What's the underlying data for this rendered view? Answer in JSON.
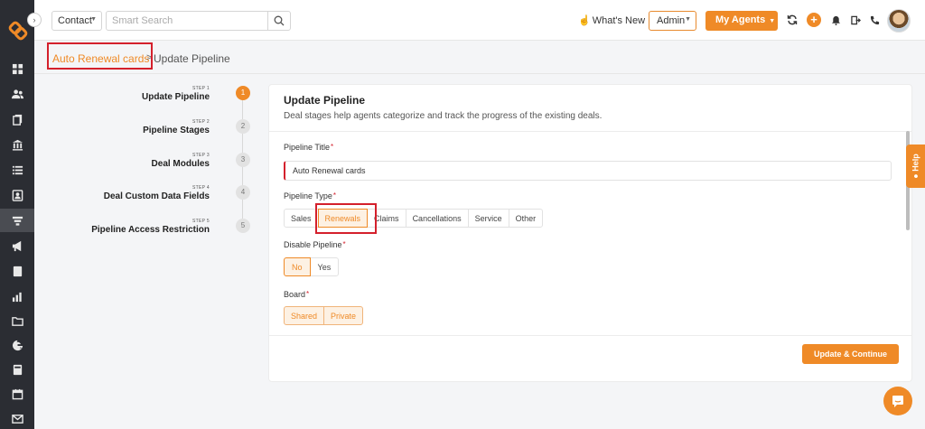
{
  "topbar": {
    "contact_select": "Contact",
    "search_placeholder": "Smart Search",
    "whats_new": "What's New",
    "admin_select": "Admin",
    "agents_button": "My Agents",
    "plus": "+"
  },
  "breadcrumb": {
    "parent": "Auto Renewal cards",
    "separator": ">",
    "current": "Update Pipeline"
  },
  "steps": [
    {
      "step": "STEP 1",
      "label": "Update Pipeline",
      "number": "1",
      "active": true
    },
    {
      "step": "STEP 2",
      "label": "Pipeline Stages",
      "number": "2",
      "active": false
    },
    {
      "step": "STEP 3",
      "label": "Deal Modules",
      "number": "3",
      "active": false
    },
    {
      "step": "STEP 4",
      "label": "Deal Custom Data Fields",
      "number": "4",
      "active": false
    },
    {
      "step": "STEP 5",
      "label": "Pipeline Access Restriction",
      "number": "5",
      "active": false
    }
  ],
  "card": {
    "title": "Update Pipeline",
    "description": "Deal stages help agents categorize and track the progress of the existing deals.",
    "pipeline_title_label": "Pipeline Title",
    "pipeline_title_value": "Auto Renewal cards",
    "pipeline_type_label": "Pipeline Type",
    "pipeline_types": [
      "Sales",
      "Renewals",
      "Claims",
      "Cancellations",
      "Service",
      "Other"
    ],
    "pipeline_type_selected": "Renewals",
    "disable_pipeline_label": "Disable Pipeline",
    "disable_options": [
      "No",
      "Yes"
    ],
    "disable_selected": "No",
    "board_label": "Board",
    "board_options": [
      "Shared",
      "Private"
    ],
    "required_mark": "*",
    "submit_button": "Update & Continue"
  },
  "help_tab": "Help",
  "colors": {
    "accent": "#ef8a27",
    "sidebar": "#2b2d33",
    "highlight": "#d4202c"
  },
  "icons": {
    "sidebar": [
      "dashboard-icon",
      "contacts-icon",
      "documents-icon",
      "bank-icon",
      "list-icon",
      "contact-card-icon",
      "pipeline-funnel-icon",
      "megaphone-icon",
      "notes-icon",
      "reports-icon",
      "folder-icon",
      "google-icon",
      "calculator-icon",
      "calendar-icon",
      "mail-icon"
    ],
    "topbar": [
      "search-icon",
      "refresh-icon",
      "plus-icon",
      "bell-icon",
      "exit-icon",
      "phone-icon"
    ]
  }
}
